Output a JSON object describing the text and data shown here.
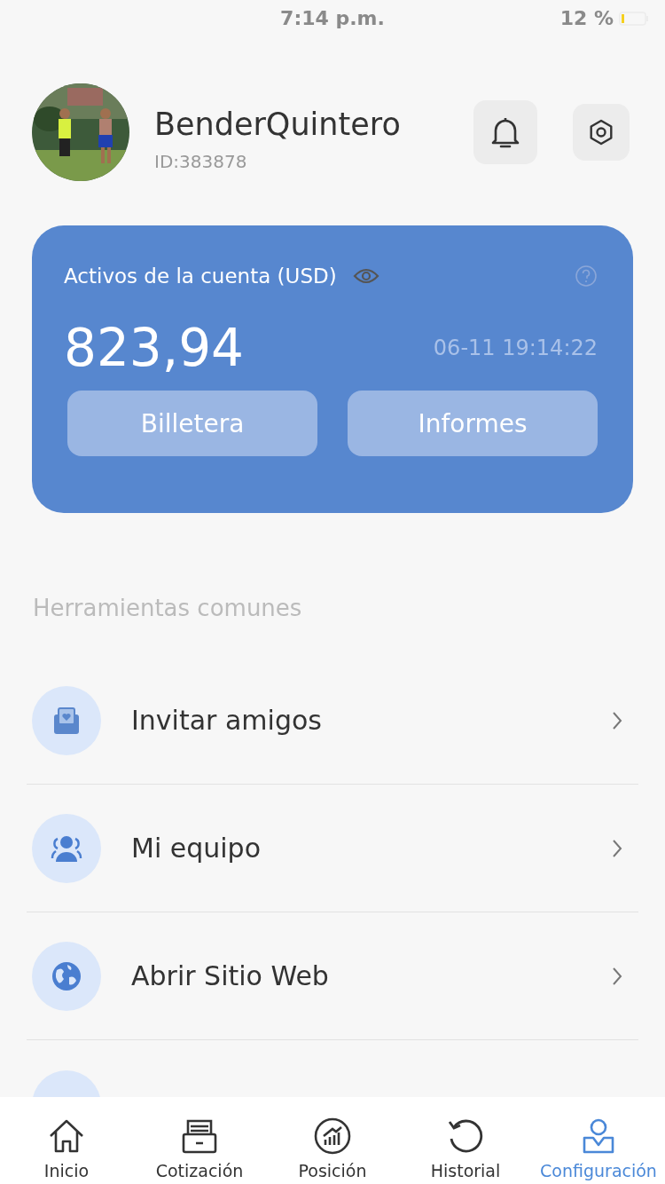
{
  "status_bar": {
    "time": "7:14 p.m.",
    "battery": "12 %"
  },
  "profile": {
    "name": "BenderQuintero",
    "id": "ID:383878"
  },
  "account": {
    "title": "Activos de la cuenta (USD)",
    "amount": "823,94",
    "timestamp": "06-11 19:14:22",
    "buttons": [
      "Billetera",
      "Informes"
    ]
  },
  "tools": {
    "title": "Herramientas comunes",
    "items": [
      {
        "label": "Invitar amigos",
        "kind": "invite"
      },
      {
        "label": "Mi equipo",
        "kind": "team"
      },
      {
        "label": "Abrir Sitio Web",
        "kind": "web"
      }
    ]
  },
  "tab_bar": [
    {
      "label": "Inicio",
      "kind": "home",
      "selected": false
    },
    {
      "label": "Cotización",
      "kind": "quote",
      "selected": false
    },
    {
      "label": "Posición",
      "kind": "position",
      "selected": false
    },
    {
      "label": "Historial",
      "kind": "history",
      "selected": false
    },
    {
      "label": "Configuración",
      "kind": "profile",
      "selected": true
    }
  ]
}
